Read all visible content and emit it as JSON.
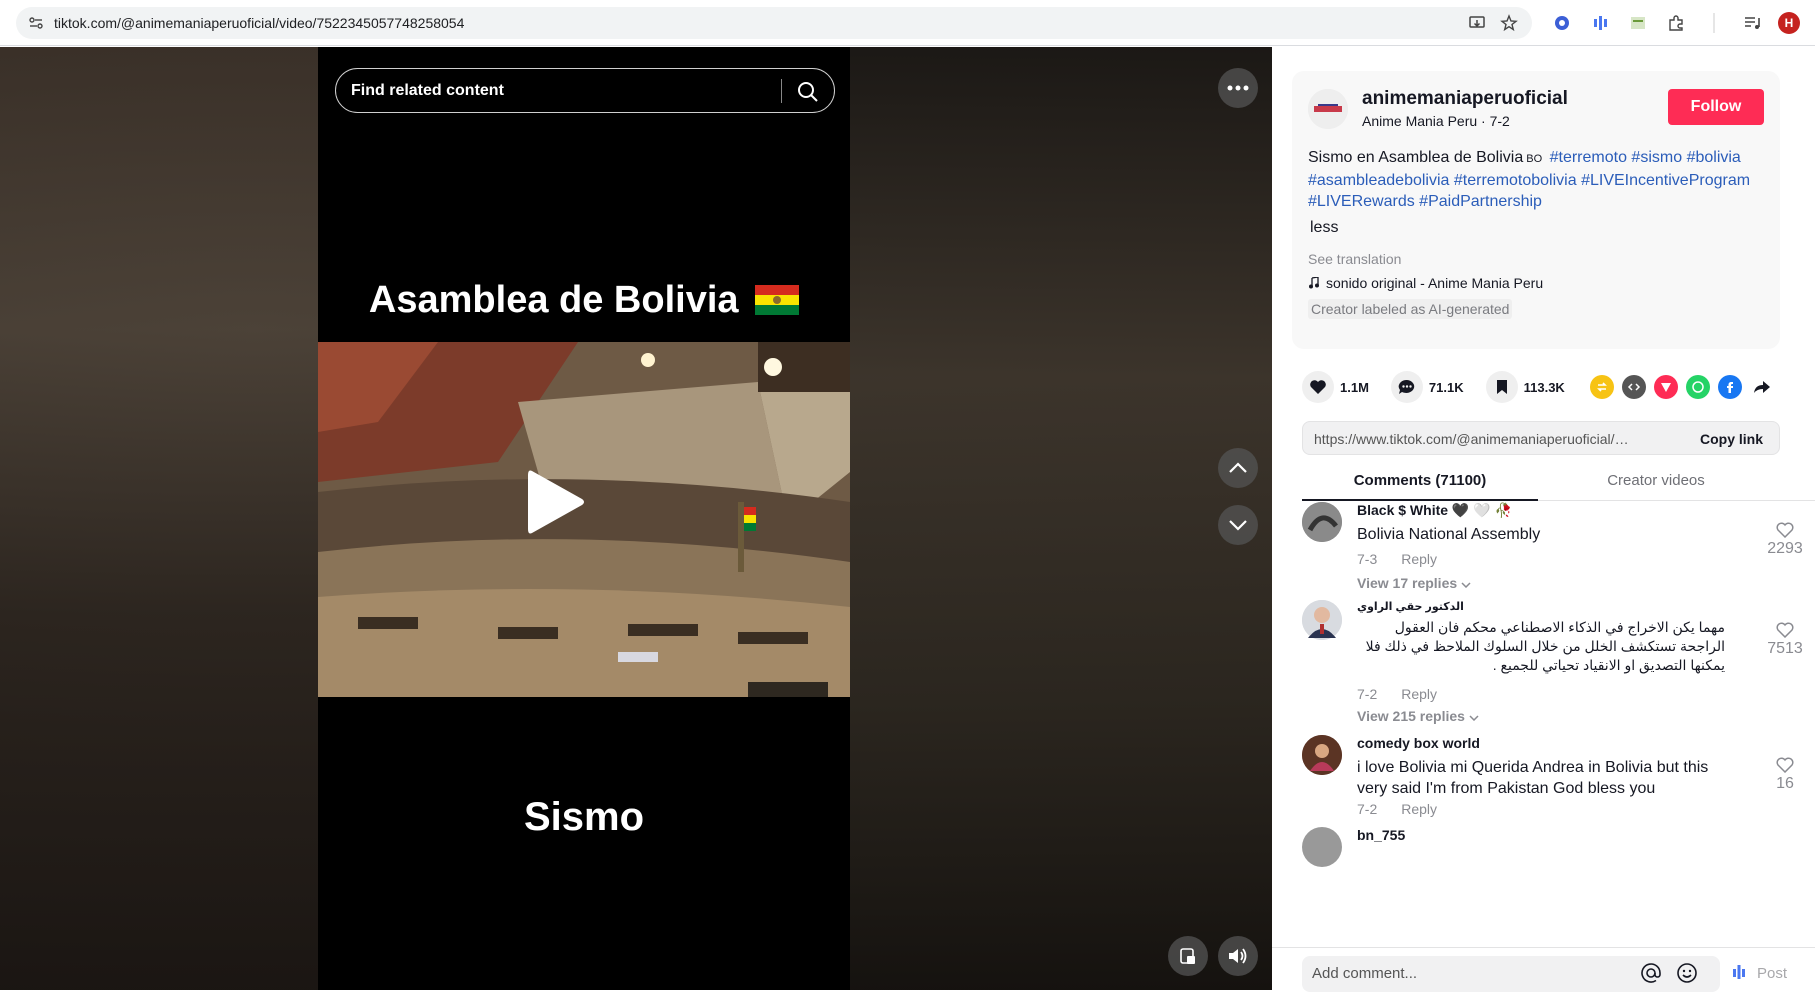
{
  "browser": {
    "url": "tiktok.com/@animemaniaperuoficial/video/7522345057748258054",
    "profile_initial": "H"
  },
  "video": {
    "search_placeholder": "Find related content",
    "overlay_title": "Asamblea de Bolivia",
    "overlay_bottom": "Sismo"
  },
  "creator": {
    "username": "animemaniaperuoficial",
    "subtitle": "Anime Mania Peru · 7-2",
    "follow_label": "Follow"
  },
  "description": {
    "text": "Sismo en Asamblea de Bolivia",
    "flag_code": "BO",
    "hashtags": [
      "#terremoto",
      "#sismo",
      "#bolivia",
      "#asambleadebolivia",
      "#terremotobolivia",
      "#LIVEIncentiveProgram",
      "#LIVERewards",
      "#PaidPartnership"
    ],
    "less_label": "less",
    "see_translation": "See translation",
    "music": "sonido original - Anime Mania Peru",
    "ai_label": "Creator labeled as AI-generated"
  },
  "stats": {
    "likes": "1.1M",
    "comments": "71.1K",
    "saves": "113.3K"
  },
  "link": {
    "url": "https://www.tiktok.com/@animemaniaperuoficial/vide...",
    "copy_label": "Copy link"
  },
  "tabs": {
    "comments": "Comments (71100)",
    "creator_videos": "Creator videos"
  },
  "comments": [
    {
      "name": "Black $ White 🖤 🤍 🥀",
      "text": "Bolivia National Assembly",
      "date": "7-3",
      "reply": "Reply",
      "view": "View 17 replies",
      "likes": "2293"
    },
    {
      "name": "الدكتور حقي الراوي",
      "text": "مهما يكن الاخراج في الذكاء الاصطناعي محكم فان العقول الراجحة تستكشف الخلل من خلال السلوك الملاحظ في ذلك فلا يمكنها التصديق او الانقياد تحياتي للجميع .",
      "date": "7-2",
      "reply": "Reply",
      "view": "View 215 replies",
      "likes": "7513"
    },
    {
      "name": "comedy box world",
      "text": "i love Bolivia mi Querida Andrea in Bolivia but this very said I'm from Pakistan God bless you",
      "date": "7-2",
      "reply": "Reply",
      "likes": "16"
    },
    {
      "name": "bn_755"
    }
  ],
  "add_comment": {
    "placeholder": "Add comment...",
    "post_label": "Post"
  },
  "colors": {
    "accent": "#fe2c55",
    "hashtag": "#2b5db9"
  }
}
